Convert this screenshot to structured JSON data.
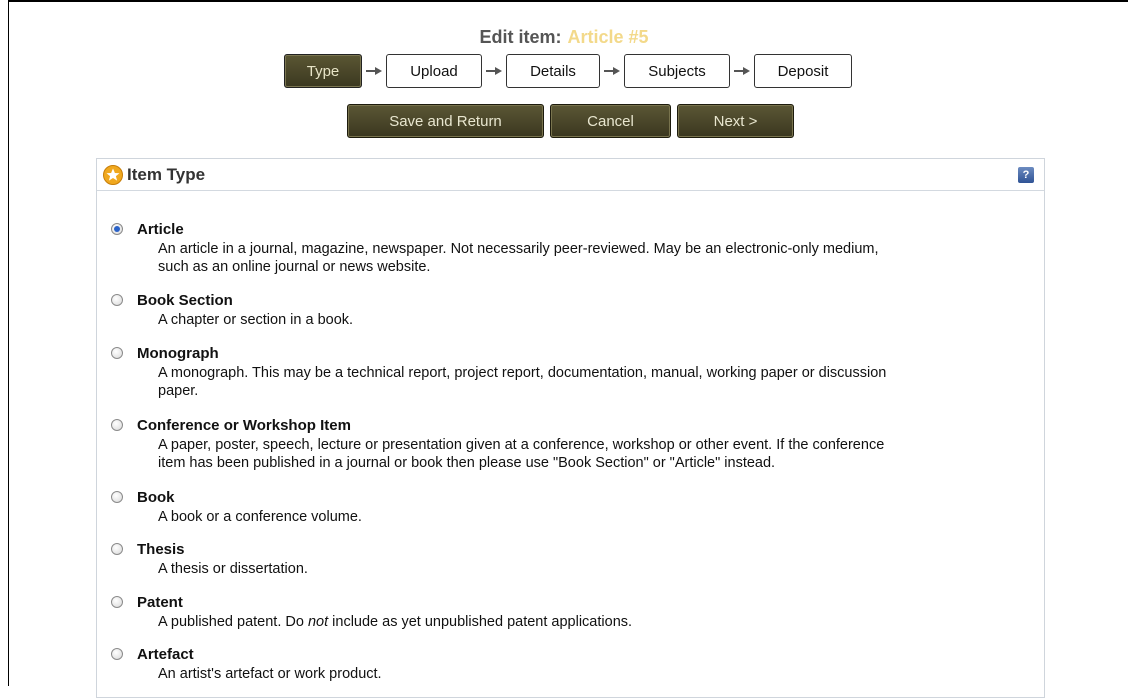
{
  "header": {
    "title_prefix": "Edit item:",
    "item_link": "Article #5"
  },
  "stages": [
    {
      "label": "Type",
      "current": true
    },
    {
      "label": "Upload",
      "current": false
    },
    {
      "label": "Details",
      "current": false
    },
    {
      "label": "Subjects",
      "current": false
    },
    {
      "label": "Deposit",
      "current": false
    }
  ],
  "actions": {
    "save_return": "Save and Return",
    "cancel": "Cancel",
    "next": "Next >"
  },
  "panel": {
    "title": "Item Type",
    "help_glyph": "?"
  },
  "item_types": [
    {
      "name": "Article",
      "selected": true,
      "desc_1": "An article in a journal, magazine, newspaper. Not necessarily peer-reviewed. May be an electronic-only medium,",
      "desc_2": "such as an online journal or news website."
    },
    {
      "name": "Book Section",
      "selected": false,
      "desc_1": "A chapter or section in a book.",
      "desc_2": ""
    },
    {
      "name": "Monograph",
      "selected": false,
      "desc_1": "A monograph. This may be a technical report, project report, documentation, manual, working paper or discussion",
      "desc_2": "paper."
    },
    {
      "name": "Conference or Workshop Item",
      "selected": false,
      "desc_1": "A paper, poster, speech, lecture or presentation given at a conference, workshop or other event. If the conference",
      "desc_2": "item has been published in a journal or book then please use \"Book Section\" or \"Article\" instead."
    },
    {
      "name": "Book",
      "selected": false,
      "desc_1": "A book or a conference volume.",
      "desc_2": ""
    },
    {
      "name": "Thesis",
      "selected": false,
      "desc_1": "A thesis or dissertation.",
      "desc_2": ""
    },
    {
      "name": "Patent",
      "selected": false,
      "desc_1": "A published patent. Do ",
      "desc_em": "not",
      "desc_tail": " include as yet unpublished patent applications.",
      "desc_2": ""
    },
    {
      "name": "Artefact",
      "selected": false,
      "desc_1": "An artist's artefact or work product.",
      "desc_2": ""
    }
  ],
  "colors": {
    "button_bg": "#4a4629",
    "item_link": "#f3d98a",
    "help_icon": "#3d5f9f"
  }
}
